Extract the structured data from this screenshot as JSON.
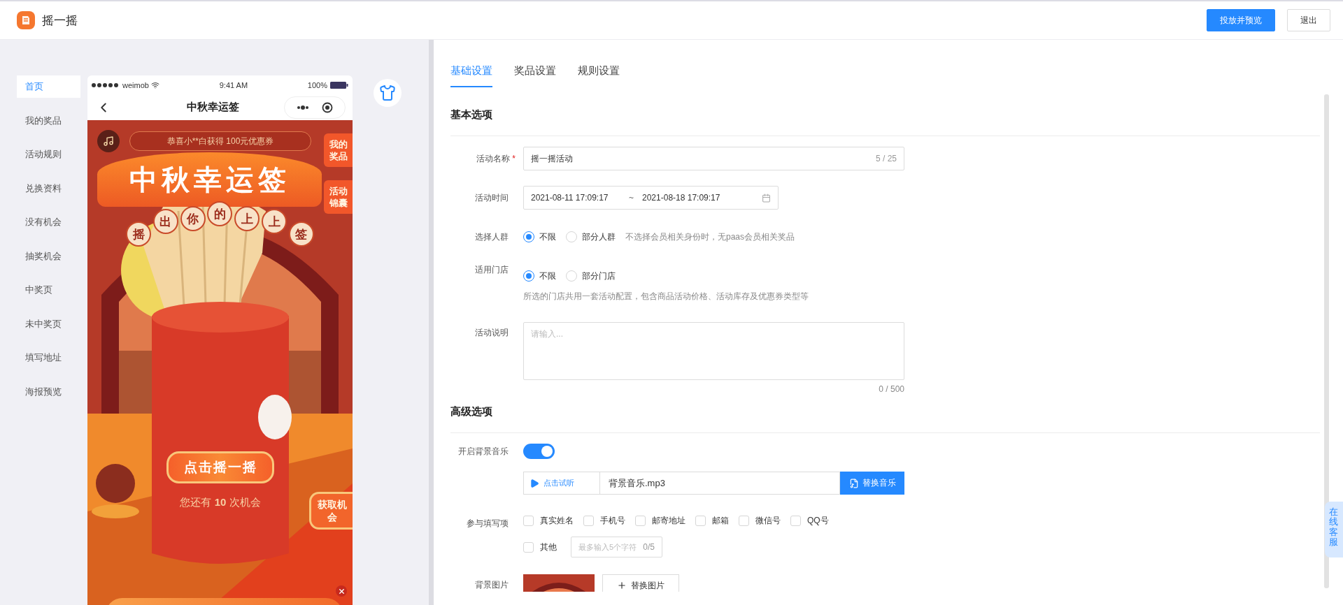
{
  "header": {
    "title": "摇一摇",
    "buttons": [
      {
        "label": "投放并预览",
        "kind": "primary"
      },
      {
        "label": "退出",
        "kind": "default"
      }
    ]
  },
  "sidebar": {
    "items": [
      {
        "label": "首页",
        "selected": true
      },
      {
        "label": "我的奖品",
        "selected": false
      },
      {
        "label": "活动规则",
        "selected": false
      },
      {
        "label": "兑换资料",
        "selected": false
      },
      {
        "label": "没有机会",
        "selected": false
      },
      {
        "label": "抽奖机会",
        "selected": false
      },
      {
        "label": "中奖页",
        "selected": false
      },
      {
        "label": "未中奖页",
        "selected": false
      },
      {
        "label": "填写地址",
        "selected": false
      },
      {
        "label": "海报预览",
        "selected": false
      }
    ]
  },
  "phone": {
    "status": {
      "carrier": "weimob",
      "time": "9:41 AM",
      "battery": "100%"
    },
    "nav_title": "中秋幸运签",
    "notice": "恭喜小**白获得 100元优惠券",
    "side_buttons": [
      "我的奖品",
      "活动锦囊"
    ],
    "banner_title": "中秋幸运签",
    "banner_subtitle": "摇出你的上上签",
    "shake_button": "点击摇一摇",
    "chances": "您还有 **10** 次机会",
    "get_chance": "获取机会"
  },
  "tabs": [
    {
      "label": "基础设置",
      "selected": true
    },
    {
      "label": "奖品设置",
      "selected": false
    },
    {
      "label": "规则设置",
      "selected": false
    }
  ],
  "sections": [
    {
      "title": "基本选项",
      "fields": [
        {
          "kind": "text",
          "label": "活动名称",
          "required_mark": "*",
          "value": "摇一摇活动",
          "counter": "5 / 25"
        },
        {
          "kind": "daterange",
          "label": "活动时间",
          "start": "2021-08-11 17:09:17",
          "separator": "~",
          "end": "2021-08-18 17:09:17"
        },
        {
          "kind": "radio",
          "label": "选择人群",
          "options": [
            {
              "label": "不限",
              "selected": true
            },
            {
              "label": "部分人群",
              "selected": false
            }
          ],
          "hint": "不选择会员相关身份时，无paas会员相关奖品"
        },
        {
          "kind": "radio",
          "label": "适用门店",
          "options": [
            {
              "label": "不限",
              "selected": true
            },
            {
              "label": "部分门店",
              "selected": false
            }
          ],
          "note": "所选的门店共用一套活动配置，包含商品活动价格、活动库存及优惠券类型等"
        },
        {
          "kind": "textarea",
          "label": "活动说明",
          "placeholder": "请输入...",
          "counter": "0 / 500"
        }
      ]
    },
    {
      "title": "高级选项",
      "fields": [
        {
          "kind": "toggle",
          "label": "开启背景音乐",
          "on": true
        },
        {
          "kind": "music",
          "play_label": "点击试听",
          "file": "背景音乐.mp3",
          "button": "替换音乐"
        },
        {
          "kind": "checkboxes",
          "label": "参与填写项",
          "options": [
            {
              "label": "真实姓名",
              "checked": false
            },
            {
              "label": "手机号",
              "checked": false
            },
            {
              "label": "邮寄地址",
              "checked": false
            },
            {
              "label": "邮箱",
              "checked": false
            },
            {
              "label": "微信号",
              "checked": false
            },
            {
              "label": "QQ号",
              "checked": false
            }
          ],
          "other": {
            "label": "其他",
            "checked": false,
            "placeholder": "最多输入5个字符",
            "counter": "0/5"
          }
        },
        {
          "label": "背景图片",
          "button": "替换图片"
        }
      ]
    }
  ],
  "service_tab": "在线客服"
}
